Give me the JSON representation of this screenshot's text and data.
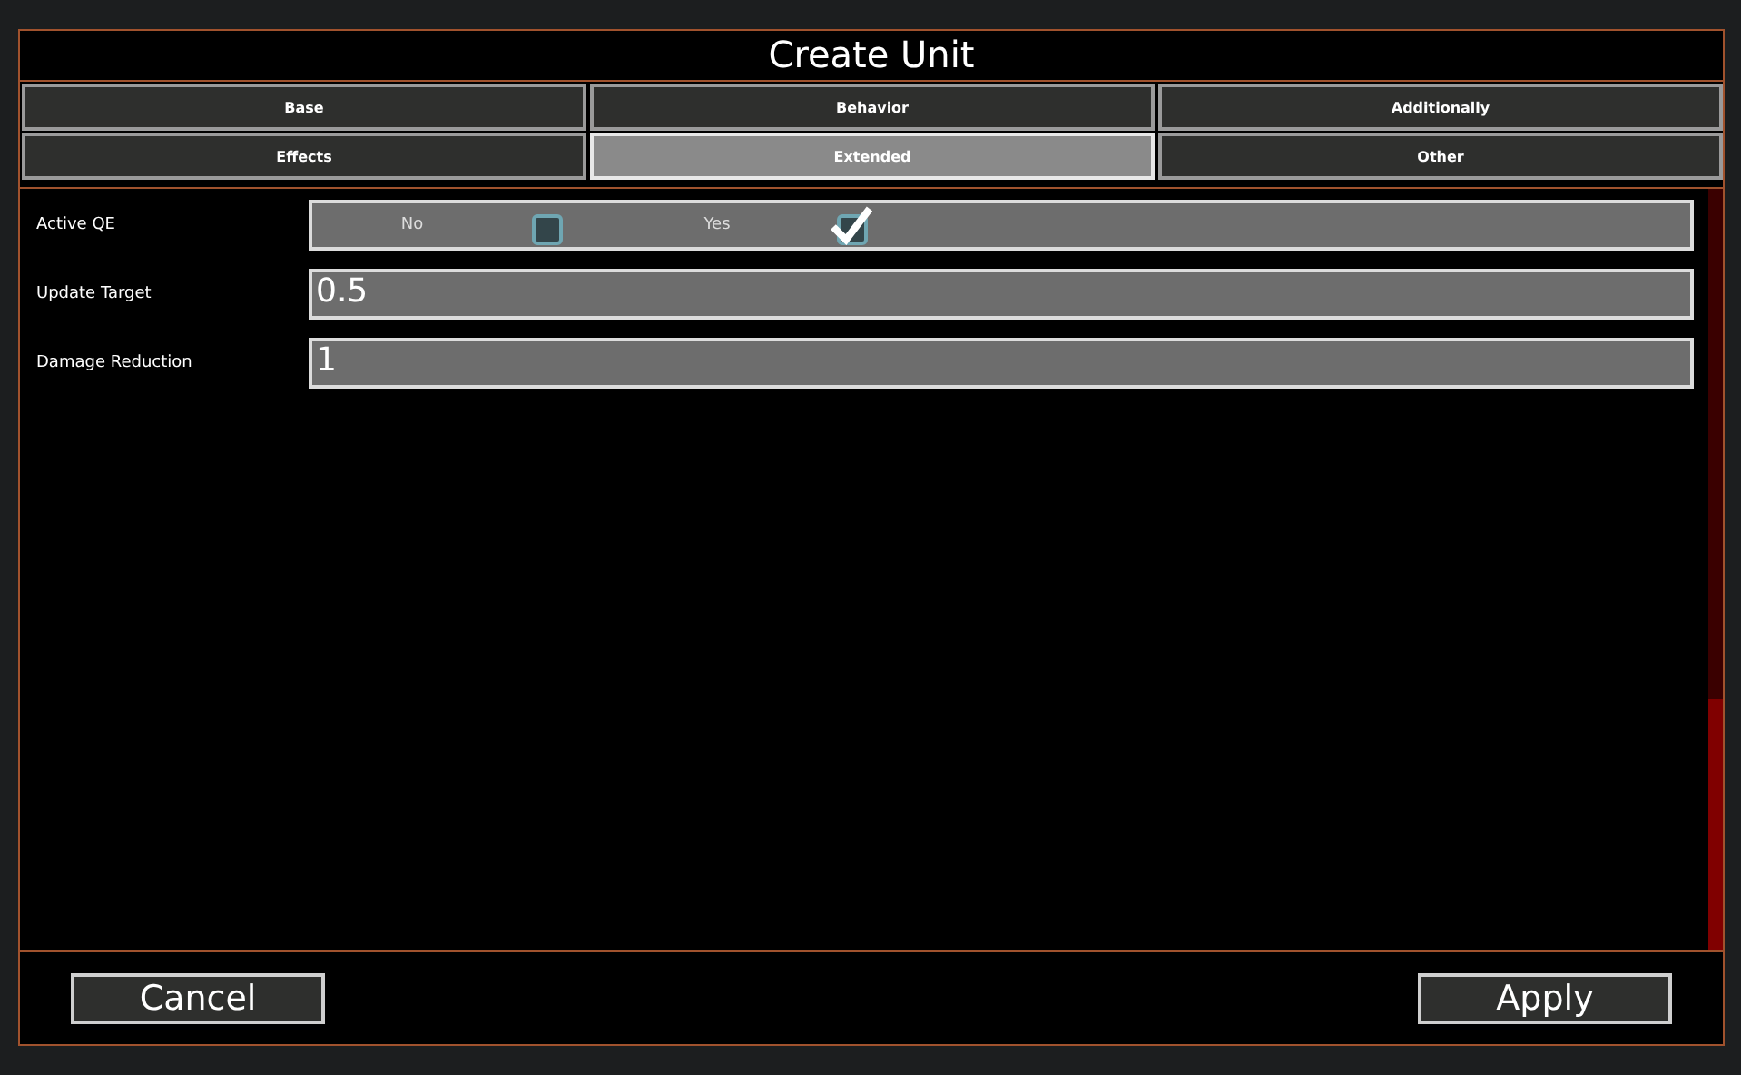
{
  "window": {
    "title": "Create Unit"
  },
  "tabs": [
    {
      "label": "Base",
      "selected": false
    },
    {
      "label": "Behavior",
      "selected": false
    },
    {
      "label": "Additionally",
      "selected": false
    },
    {
      "label": "Effects",
      "selected": false
    },
    {
      "label": "Extended",
      "selected": true
    },
    {
      "label": "Other",
      "selected": false
    }
  ],
  "fields": [
    {
      "kind": "toggle",
      "label": "Active QE",
      "options": [
        {
          "label": "No",
          "checked": false
        },
        {
          "label": "Yes",
          "checked": true
        }
      ]
    },
    {
      "kind": "number",
      "label": "Update Target",
      "value": "0.5"
    },
    {
      "kind": "number",
      "label": "Damage Reduction",
      "value": "1"
    }
  ],
  "buttons": [
    {
      "label": "Cancel"
    },
    {
      "label": "Apply"
    }
  ]
}
